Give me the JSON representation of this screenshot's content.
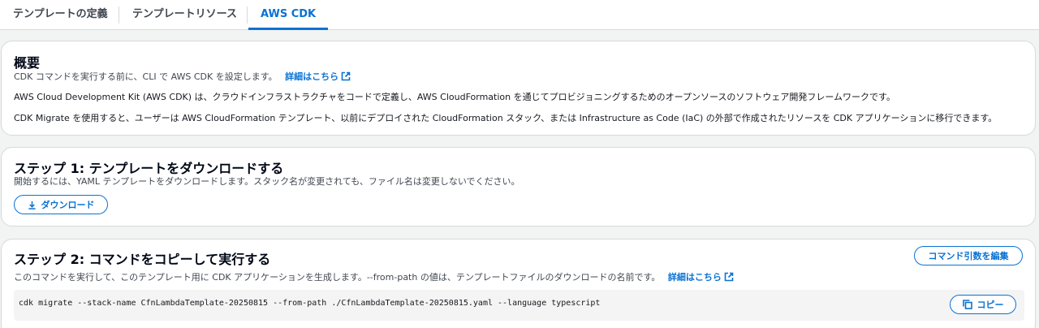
{
  "tabs": [
    {
      "label": "テンプレートの定義"
    },
    {
      "label": "テンプレートリソース"
    },
    {
      "label": "AWS CDK",
      "active": true
    }
  ],
  "overview": {
    "title": "概要",
    "description": "CDK コマンドを実行する前に、CLI で AWS CDK を設定します。",
    "learn_more": "詳細はこちら",
    "paragraph1": "AWS Cloud Development Kit (AWS CDK) は、クラウドインフラストラクチャをコードで定義し、AWS CloudFormation を通じてプロビジョニングするためのオープンソースのソフトウェア開発フレームワークです。",
    "paragraph2": "CDK Migrate を使用すると、ユーザーは AWS CloudFormation テンプレート、以前にデプロイされた CloudFormation スタック、または Infrastructure as Code (IaC) の外部で作成されたリソースを CDK アプリケーションに移行できます。"
  },
  "step1": {
    "title": "ステップ 1: テンプレートをダウンロードする",
    "description": "開始するには、YAML テンプレートをダウンロードします。スタック名が変更されても、ファイル名は変更しないでください。",
    "download_label": "ダウンロード",
    "download_icon": "download-icon"
  },
  "step2": {
    "title": "ステップ 2: コマンドをコピーして実行する",
    "description": "このコマンドを実行して、このテンプレート用に CDK アプリケーションを生成します。--from-path の値は、テンプレートファイルのダウンロードの名前です。",
    "learn_more": "詳細はこちら",
    "edit_args_label": "コマンド引数を編集",
    "command": "cdk migrate --stack-name CfnLambdaTemplate-20250815 --from-path ./CfnLambdaTemplate-20250815.yaml --language typescript",
    "copy_label": "コピー",
    "copy_icon": "copy-icon"
  },
  "colors": {
    "accent": "#0972d3",
    "border": "#d5dbdb",
    "background": "#f2f3f3"
  }
}
